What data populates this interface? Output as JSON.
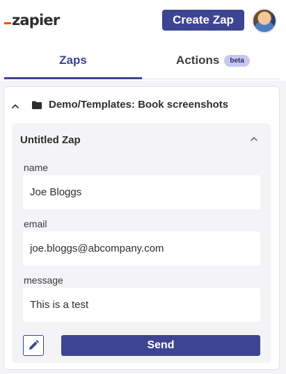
{
  "header": {
    "logo_text": "zapier",
    "create_zap_label": "Create Zap",
    "brand_color": "#3d4592",
    "logo_accent_color": "#ff4a00"
  },
  "tabs": [
    {
      "label": "Zaps",
      "active": true
    },
    {
      "label": "Actions",
      "badge": "beta",
      "active": false
    }
  ],
  "folder": {
    "title": "Demo/Templates: Book screenshots",
    "expanded": true,
    "icon": "folder-icon"
  },
  "zap": {
    "title": "Untitled Zap",
    "expanded": true,
    "fields": [
      {
        "label": "name",
        "value": "Joe Bloggs"
      },
      {
        "label": "email",
        "value": "joe.bloggs@abcompany.com"
      },
      {
        "label": "message",
        "value": "This is a test"
      }
    ],
    "send_label": "Send",
    "edit_icon": "pencil-icon"
  }
}
